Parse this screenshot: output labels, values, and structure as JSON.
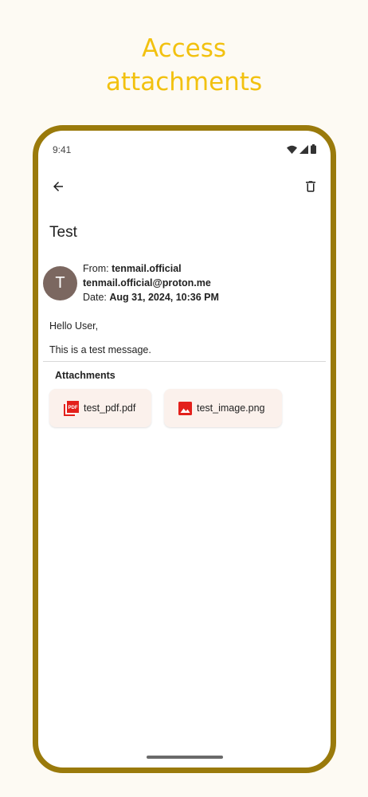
{
  "headline": {
    "line1": "Access",
    "line2": "attachments"
  },
  "status_bar": {
    "time": "9:41"
  },
  "email": {
    "subject": "Test",
    "avatar_initial": "T",
    "from_label": "From: ",
    "from_name": "tenmail.official",
    "from_email": "tenmail.official@proton.me",
    "date_label": "Date: ",
    "date_value": "Aug 31, 2024, 10:36 PM",
    "body_lines": [
      "Hello User,",
      "This is a test message."
    ]
  },
  "attachments": {
    "title": "Attachments",
    "items": [
      {
        "name": "test_pdf.pdf",
        "icon": "pdf-icon"
      },
      {
        "name": "test_image.png",
        "icon": "image-icon"
      }
    ]
  },
  "colors": {
    "headline": "#f2c10f",
    "frame": "#9a7a0b",
    "avatar": "#7b6760",
    "attachment_chip": "#fbf1ec",
    "file_icon_red": "#e3201b"
  }
}
